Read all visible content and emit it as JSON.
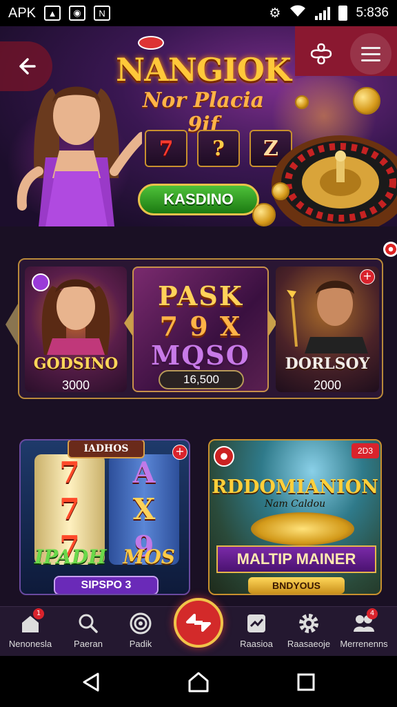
{
  "status_bar": {
    "apk_label": "APK",
    "time": "5:836"
  },
  "icons": {
    "back": "back-arrow-icon",
    "clover": "clover-icon",
    "menu": "hamburger-menu-icon",
    "home": "home-icon",
    "search": "search-icon",
    "target": "target-icon",
    "exchange": "exchange-arrows-icon",
    "records": "chart-icon",
    "settings": "gear-icon",
    "members": "group-icon"
  },
  "hero": {
    "title": "NANGIOK",
    "subtitle": "Nor Placia 9if",
    "slots": [
      "7",
      "?",
      "Z"
    ],
    "play_button": "KASDINO"
  },
  "featured": {
    "cards": [
      {
        "name": "GODSINO",
        "value": "3000"
      },
      {
        "lines": [
          "PASK",
          "7 9 X",
          "MQSO"
        ],
        "value": "16,500"
      },
      {
        "name": "DORLSOY",
        "value": "2000"
      }
    ]
  },
  "games": {
    "left": {
      "label": "IADHOS",
      "reel1": [
        "7",
        "7",
        "7"
      ],
      "reel2": [
        "A",
        "X",
        "9"
      ],
      "title_left": "IPADH",
      "title_right": "MOS",
      "button": "SIPSPO 3"
    },
    "right": {
      "tag": "2D3",
      "title": "RDDOMIANION",
      "subtitle": "Nam Caldou",
      "banner": "MALTIP MAINER",
      "button": "BNDYOUS"
    }
  },
  "bottom_nav": {
    "items": [
      {
        "label": "Nenonesla",
        "badge": "1"
      },
      {
        "label": "Paeran"
      },
      {
        "label": "Padik"
      },
      {
        "label": "Raasioa"
      },
      {
        "label": "Raasaeoje"
      },
      {
        "label": "Merrenenns",
        "badge": "4"
      }
    ]
  },
  "colors": {
    "accent_gold": "#ffc83a",
    "accent_red": "#d32a2a",
    "play_green": "#3aa82a",
    "bg": "#1a1024"
  }
}
